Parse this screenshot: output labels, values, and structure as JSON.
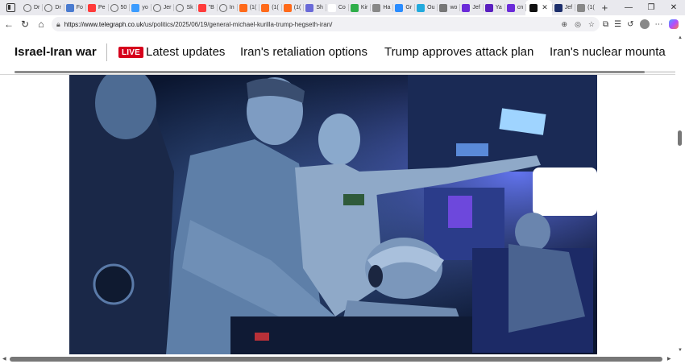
{
  "browser": {
    "tabs": [
      {
        "label": "Dr",
        "fav": "globe"
      },
      {
        "label": "Dr",
        "fav": "globe"
      },
      {
        "label": "Fo",
        "fav": "#4a7bd0"
      },
      {
        "label": "Pe",
        "fav": "#ff3b3b"
      },
      {
        "label": "50",
        "fav": "globe"
      },
      {
        "label": "yo",
        "fav": "#3b9cff"
      },
      {
        "label": "Jer",
        "fav": "globe"
      },
      {
        "label": "Sk",
        "fav": "globe"
      },
      {
        "label": "\"B",
        "fav": "#ff3b3b"
      },
      {
        "label": "In",
        "fav": "globe"
      },
      {
        "label": "(1(",
        "fav": "#ff6a1a"
      },
      {
        "label": "(1(",
        "fav": "#ff6a1a"
      },
      {
        "label": "(1(",
        "fav": "#ff6a1a"
      },
      {
        "label": "Sh",
        "fav": "#6a6ad8"
      },
      {
        "label": "Co",
        "fav": "#ffffff"
      },
      {
        "label": "Kir",
        "fav": "#2fae4a"
      },
      {
        "label": "Ha",
        "fav": "#888888"
      },
      {
        "label": "Gr",
        "fav": "#2a8cff"
      },
      {
        "label": "Ou",
        "fav": "#22aadd"
      },
      {
        "label": "wo",
        "fav": "#777777"
      },
      {
        "label": "Jef",
        "fav": "#6b2bd9"
      },
      {
        "label": "Ya",
        "fav": "#5a1fbf"
      },
      {
        "label": "cn",
        "fav": "#6b2bd9"
      },
      {
        "label": "",
        "fav": "#111111",
        "active": true
      },
      {
        "label": "Jef",
        "fav": "#1c2e6b"
      },
      {
        "label": "(1(",
        "fav": "#888888"
      }
    ],
    "url_host": "https://www.telegraph.co.uk",
    "url_path": "/us/politics/2025/06/19/general-michael-kurilla-trump-hegseth-iran/"
  },
  "topic_bar": {
    "title": "Israel-Iran war",
    "live_badge": "LIVE",
    "links": [
      {
        "label": "Latest updates",
        "name": "topic-link-latest-updates"
      },
      {
        "label": "Iran's retaliation options",
        "name": "topic-link-retaliation-options"
      },
      {
        "label": "Trump approves attack plan",
        "name": "topic-link-attack-plan"
      },
      {
        "label": "Iran's nuclear mounta",
        "name": "topic-link-nuclear-mountain"
      }
    ]
  },
  "colors": {
    "live_red": "#d6001c",
    "photo_base": "#0a1428"
  }
}
